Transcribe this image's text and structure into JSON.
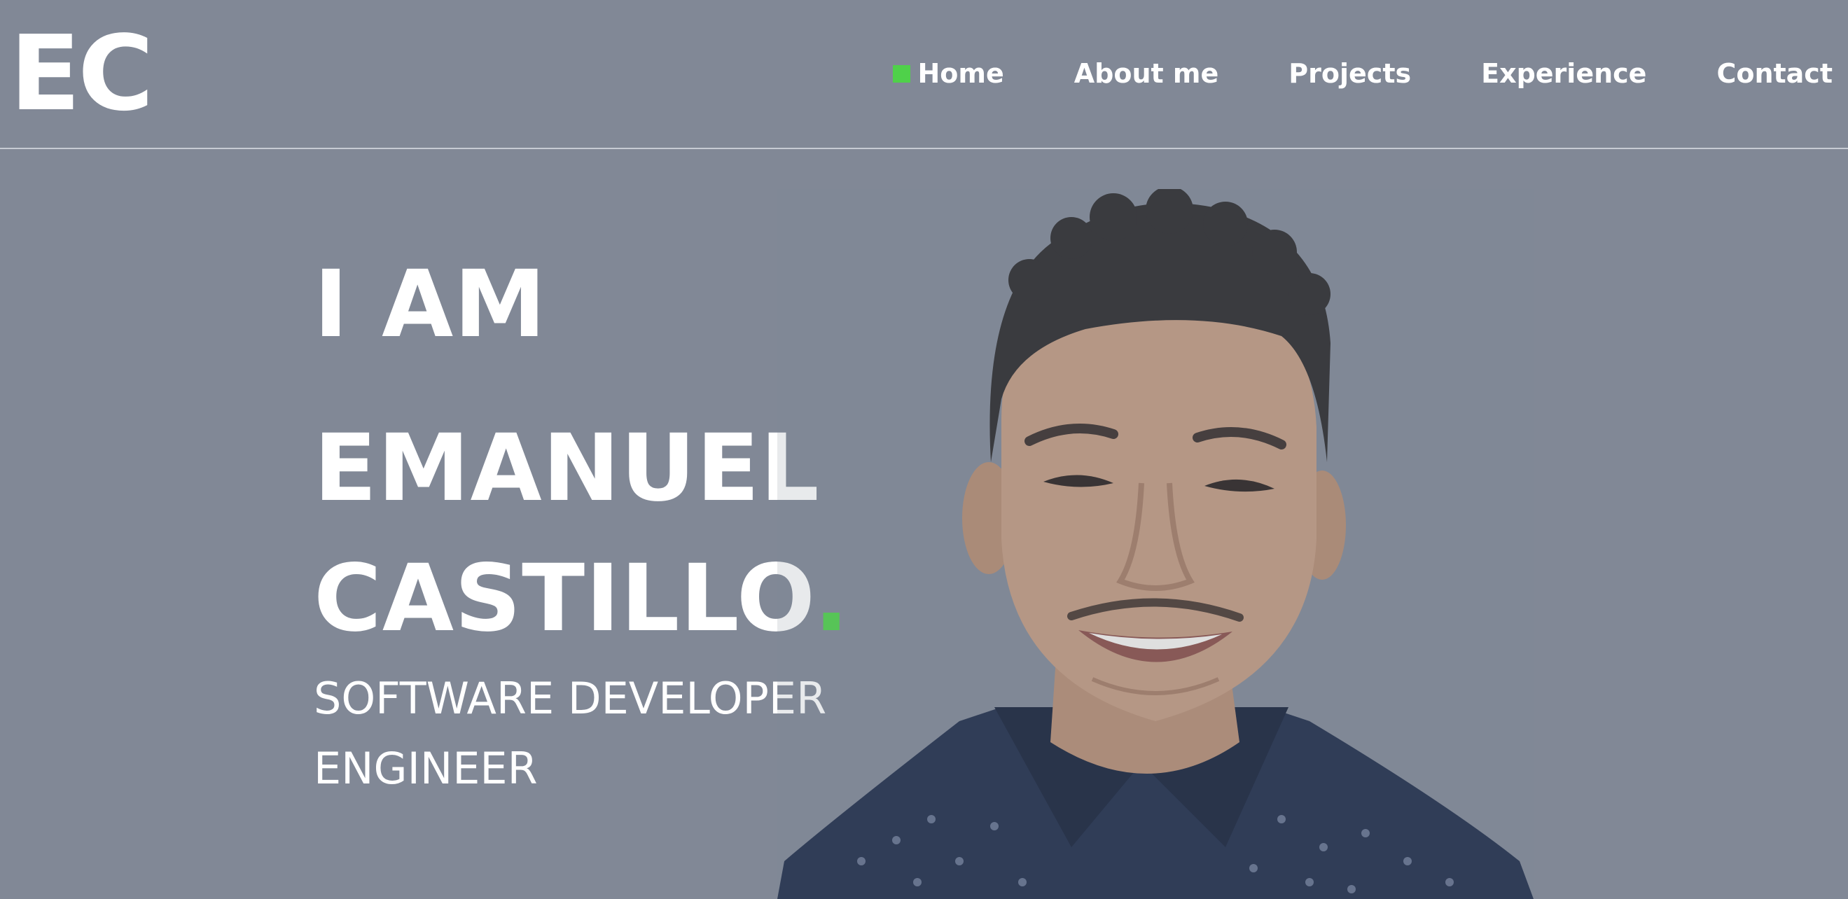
{
  "header": {
    "logo": "EC",
    "nav": [
      {
        "label": "Home",
        "active": true
      },
      {
        "label": "About me",
        "active": false
      },
      {
        "label": "Projects",
        "active": false
      },
      {
        "label": "Experience",
        "active": false
      },
      {
        "label": "Contact",
        "active": false
      }
    ]
  },
  "hero": {
    "line1": "I AM",
    "line2": "EMANUEL",
    "line3": "CASTILLO",
    "line3_dot": ".",
    "subtitle_line1": "SOFTWARE DEVELOPER",
    "subtitle_line2": "ENGINEER"
  },
  "colors": {
    "background": "#818896",
    "accent": "#4fd14a",
    "text": "#ffffff"
  }
}
